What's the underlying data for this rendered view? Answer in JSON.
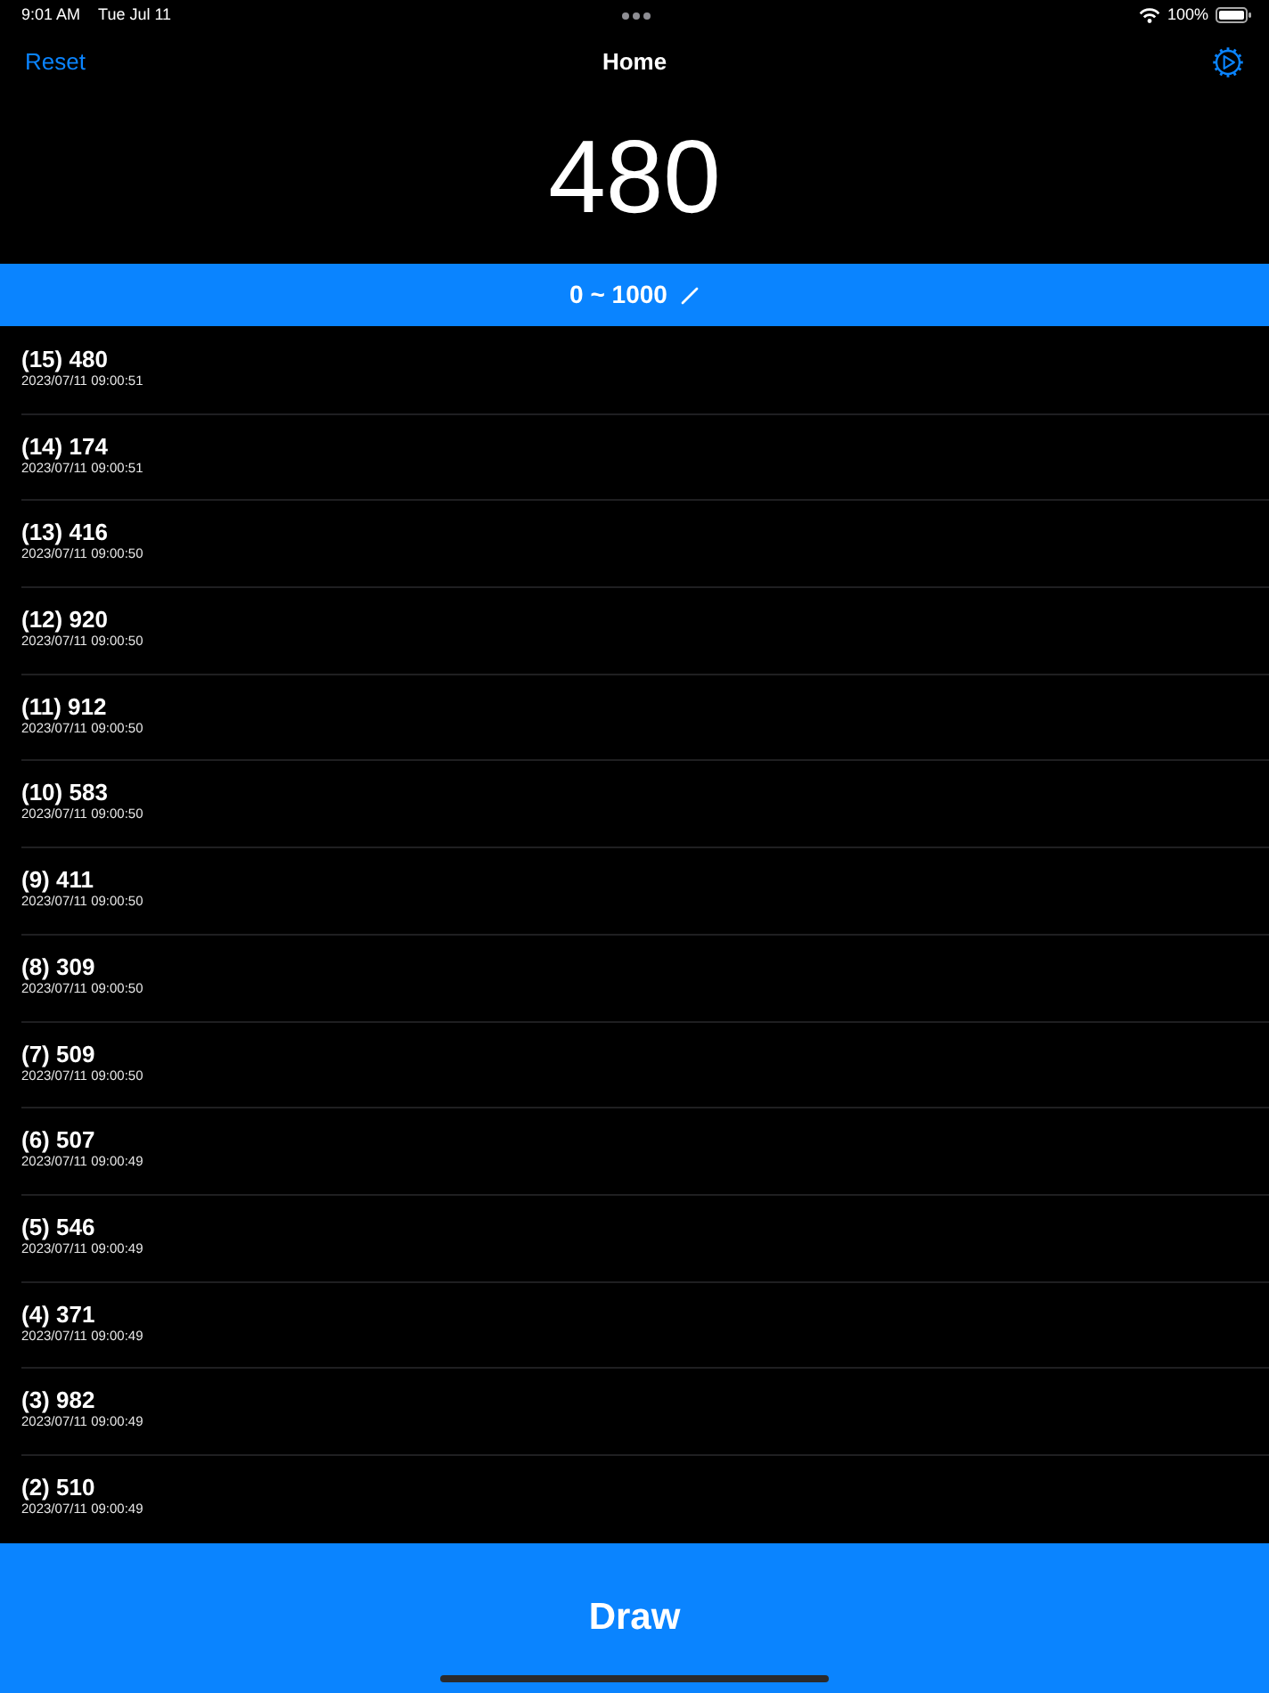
{
  "status_bar": {
    "time": "9:01 AM",
    "date": "Tue Jul 11",
    "battery": "100%"
  },
  "nav": {
    "left_button": "Reset",
    "title": "Home"
  },
  "current_value": "480",
  "range": {
    "label": "0 ~ 1000"
  },
  "history": [
    {
      "title": "(15) 480",
      "timestamp": "2023/07/11 09:00:51"
    },
    {
      "title": "(14) 174",
      "timestamp": "2023/07/11 09:00:51"
    },
    {
      "title": "(13) 416",
      "timestamp": "2023/07/11 09:00:50"
    },
    {
      "title": "(12) 920",
      "timestamp": "2023/07/11 09:00:50"
    },
    {
      "title": "(11) 912",
      "timestamp": "2023/07/11 09:00:50"
    },
    {
      "title": "(10) 583",
      "timestamp": "2023/07/11 09:00:50"
    },
    {
      "title": "(9) 411",
      "timestamp": "2023/07/11 09:00:50"
    },
    {
      "title": "(8) 309",
      "timestamp": "2023/07/11 09:00:50"
    },
    {
      "title": "(7) 509",
      "timestamp": "2023/07/11 09:00:50"
    },
    {
      "title": "(6) 507",
      "timestamp": "2023/07/11 09:00:49"
    },
    {
      "title": "(5) 546",
      "timestamp": "2023/07/11 09:00:49"
    },
    {
      "title": "(4) 371",
      "timestamp": "2023/07/11 09:00:49"
    },
    {
      "title": "(3) 982",
      "timestamp": "2023/07/11 09:00:49"
    },
    {
      "title": "(2) 510",
      "timestamp": "2023/07/11 09:00:49"
    }
  ],
  "draw_button": "Draw"
}
